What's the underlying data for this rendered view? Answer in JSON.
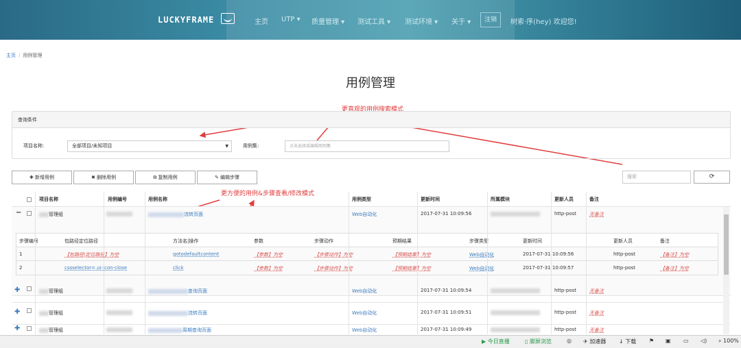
{
  "header": {
    "logo_text": "LUCKYFRAME",
    "nav": [
      "主页",
      "UTP",
      "质量管理",
      "测试工具",
      "测试环境",
      "关于"
    ],
    "login": "注销",
    "welcome": "树索·序(hey) 欢迎您!"
  },
  "breadcrumb": [
    "主页",
    "用例管理"
  ],
  "page_title": "用例管理",
  "annotations": {
    "search_mode": "更直观的用例搜索模式",
    "steps_mode": "更方便的用例&步骤查看/修改模式"
  },
  "query": {
    "panel_title": "查询条件",
    "project_label": "项目名称:",
    "project_value": "全部项目/未知项目",
    "caseset_label": "用例集:",
    "caseset_placeholder": "点击选择或编辑用例集"
  },
  "toolbar": {
    "add": "新增用例",
    "delete": "删除用例",
    "copy": "复制用例",
    "edit_steps": "编辑步骤",
    "search_placeholder": "搜索"
  },
  "table": {
    "columns": [
      "项目名称",
      "用例编号",
      "用例名称",
      "用例类型",
      "更新时间",
      "所属模块",
      "更新人员",
      "备注"
    ],
    "rows": [
      {
        "project": "管理组",
        "name_suffix": "流转页面",
        "type": "Web自动化",
        "time": "2017-07-31 10:09:56",
        "user": "http-post",
        "remark": "无备注"
      },
      {
        "project": "管理组",
        "name_suffix": "查询页面",
        "type": "Web自动化",
        "time": "2017-07-31 10:09:54",
        "user": "http-post",
        "remark": "无备注"
      },
      {
        "project": "管理组",
        "name_suffix": "流转页面",
        "type": "Web自动化",
        "time": "2017-07-31 10:09:51",
        "user": "http-post",
        "remark": "无备注"
      },
      {
        "project": "管理组",
        "name_suffix": "周期查询页面",
        "type": "Web自动化",
        "time": "2017-07-31 10:09:49",
        "user": "http-post",
        "remark": "无备注"
      }
    ]
  },
  "steps": {
    "columns": [
      "步骤编号",
      "包路径定位路径",
      "方法名|操作",
      "参数",
      "步骤动作",
      "预期结果",
      "步骤类型",
      "更新时间",
      "更新人员",
      "备注"
    ],
    "rows": [
      {
        "no": "1",
        "path": "【包路径|定位路径】为空",
        "method": "gotodefaultcontent",
        "param": "【参数】为空",
        "action": "【步骤动作】为空",
        "expected": "【预期结果】为空",
        "type": "Web自动化",
        "time": "2017-07-31 10:09:56",
        "user": "http-post",
        "remark": "【备注】为空"
      },
      {
        "no": "2",
        "path": "cssselector=.ui-icon-close",
        "method": "click",
        "param": "【参数】为空",
        "action": "【步骤动作】为空",
        "expected": "【预期结果】为空",
        "type": "Web自动化",
        "time": "2017-07-31 10:09:57",
        "user": "http-post",
        "remark": "【备注】为空"
      }
    ]
  },
  "statusbar": {
    "live": "今日直播",
    "dual": "脚屏浏览",
    "accel": "加速器",
    "download": "下载",
    "zoom": "100%"
  },
  "colors": {
    "header": "#3a8aa3",
    "link": "#3a7bbf",
    "annotation": "#e03c3c",
    "remark": "#d9534f"
  }
}
